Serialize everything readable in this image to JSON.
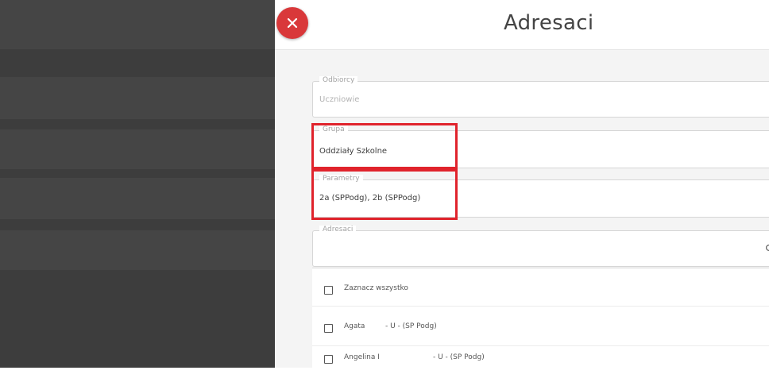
{
  "modal": {
    "title": "Adresaci"
  },
  "fields": {
    "odbiorcy": {
      "label": "Odbiorcy",
      "value": "Uczniowie"
    },
    "grupa": {
      "label": "Grupa",
      "value": "Oddziały Szkolne"
    },
    "parametry": {
      "label": "Parametry",
      "value": "2a (SPPodg), 2b (SPPodg)"
    },
    "adresaci": {
      "label": "Adresaci",
      "value": ""
    }
  },
  "list": {
    "select_all": "Zaznacz wszystko",
    "items": [
      {
        "name": "Agata",
        "detail": "- U - (SP Podg)"
      },
      {
        "name": "Angelina I",
        "detail": "- U - (SP Podg)"
      }
    ]
  },
  "colors": {
    "close": "#d9383a",
    "highlight": "#e0232c",
    "backdrop": "#3d3d3d"
  },
  "icons": {
    "close": "close-icon",
    "search": "search-icon"
  }
}
